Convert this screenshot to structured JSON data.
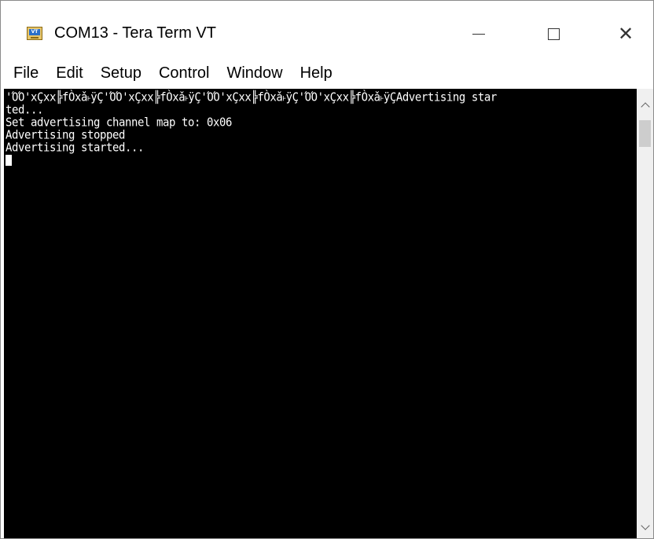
{
  "window": {
    "title": "COM13 - Tera Term VT",
    "icon": "tera-term-icon",
    "icon_label": "VT"
  },
  "title_controls": {
    "minimize_icon": "minimize-icon",
    "maximize_icon": "maximize-icon",
    "close_icon": "close-icon",
    "close_glyph": "✕"
  },
  "menu": {
    "items": [
      {
        "label": "File"
      },
      {
        "label": "Edit"
      },
      {
        "label": "Setup"
      },
      {
        "label": "Control"
      },
      {
        "label": "Window"
      },
      {
        "label": "Help"
      }
    ]
  },
  "terminal": {
    "lines": [
      "'ΌΌ'xÇxx╠fÒxǎ˫ÿÇ'ΌΌ'xÇxx╠fÒxǎ˫ÿÇ'ΌΌ'xÇxx╠fÒxǎ˫ÿÇ'ΌΌ'xÇxx╠fÒxǎ˫ÿÇAdvertising star",
      "ted...",
      "Set advertising channel map to: 0x06",
      "Advertising stopped",
      "Advertising started..."
    ],
    "background_color": "#000000",
    "text_color": "#ffffff"
  },
  "scrollbar": {
    "up_icon": "chevron-up-icon",
    "down_icon": "chevron-down-icon"
  }
}
